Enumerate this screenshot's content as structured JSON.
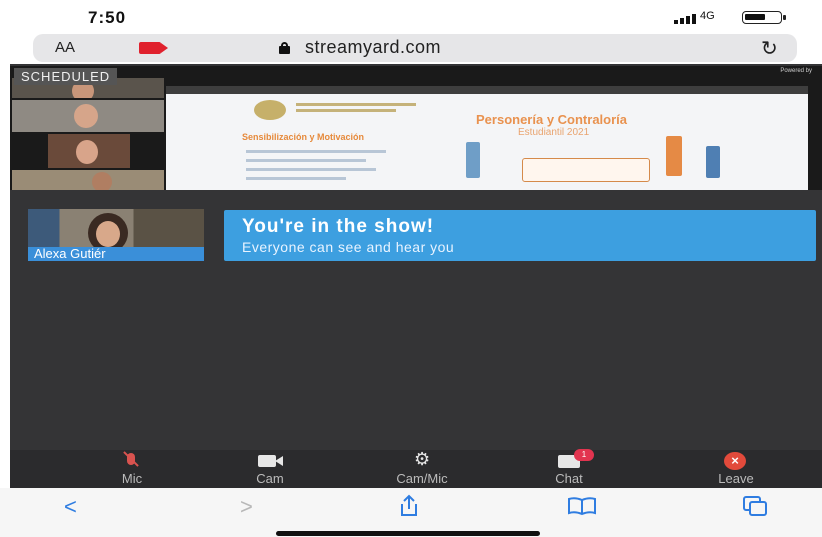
{
  "status_bar": {
    "time": "7:50",
    "network": "4G"
  },
  "browser": {
    "text_size_label": "AA",
    "domain": "streamyard.com",
    "icons": {
      "camera_indicator": "video-camera-icon",
      "lock": "lock-icon",
      "reload": "reload-icon"
    }
  },
  "stage": {
    "status_badge": "SCHEDULED",
    "powered_by": "Powered by",
    "slide": {
      "title": "Personería y Contraloría",
      "subtitle": "Estudiantil 2021",
      "heading": "Sensibilización y Motivación"
    }
  },
  "self_view": {
    "name": "Alexa Gutiér"
  },
  "banner": {
    "headline": "You're in the show!",
    "message": "Everyone can see and hear you",
    "color": "#3d9fe0"
  },
  "controls": [
    {
      "label": "Mic",
      "icon": "mic-off-icon"
    },
    {
      "label": "Cam",
      "icon": "camera-icon"
    },
    {
      "label": "Cam/Mic",
      "icon": "gear-icon"
    },
    {
      "label": "Chat",
      "icon": "chat-icon",
      "badge": "1"
    },
    {
      "label": "Leave",
      "icon": "leave-icon"
    }
  ],
  "safari_toolbar": {
    "back": "<",
    "forward": ">",
    "icons": [
      "back-icon",
      "forward-icon",
      "share-icon",
      "bookmarks-icon",
      "tabs-icon"
    ]
  }
}
